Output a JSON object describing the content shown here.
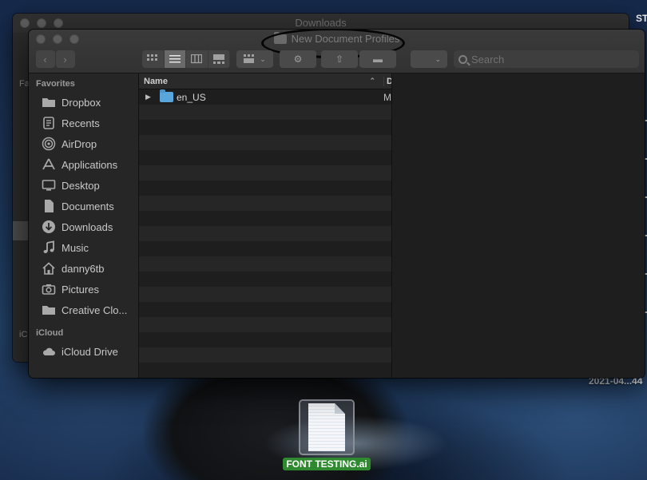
{
  "desktop": {
    "right_edge_label": "ST",
    "date_label": "2021-04...44",
    "file": {
      "name": "FONT TESTING.ai",
      "icon": "illustrator-document-icon"
    }
  },
  "background_window": {
    "title": "Downloads",
    "sidebar_fragments": [
      "Fa",
      "iC"
    ]
  },
  "finder": {
    "title": "New Document Profiles",
    "toolbar": {
      "back_icon": "chevron-left-icon",
      "forward_icon": "chevron-right-icon",
      "view_modes": [
        "icon-view",
        "list-view",
        "column-view",
        "gallery-view"
      ],
      "active_view": "list-view",
      "search_placeholder": "Search"
    },
    "sidebar": {
      "favorites_label": "Favorites",
      "favorites": [
        {
          "label": "Dropbox",
          "icon": "folder-icon"
        },
        {
          "label": "Recents",
          "icon": "recents-icon"
        },
        {
          "label": "AirDrop",
          "icon": "airdrop-icon"
        },
        {
          "label": "Applications",
          "icon": "applications-icon"
        },
        {
          "label": "Desktop",
          "icon": "desktop-icon"
        },
        {
          "label": "Documents",
          "icon": "document-icon"
        },
        {
          "label": "Downloads",
          "icon": "download-icon"
        },
        {
          "label": "Music",
          "icon": "music-icon"
        },
        {
          "label": "danny6tb",
          "icon": "home-icon"
        },
        {
          "label": "Pictures",
          "icon": "camera-icon"
        },
        {
          "label": "Creative Clo...",
          "icon": "folder-icon"
        }
      ],
      "icloud_label": "iCloud",
      "icloud": [
        {
          "label": "iCloud Drive",
          "icon": "cloud-icon"
        }
      ]
    },
    "list": {
      "columns": {
        "name": "Name",
        "date": "D"
      },
      "rows": [
        {
          "name": "en_US",
          "date": "M",
          "kind": "folder"
        }
      ]
    }
  }
}
